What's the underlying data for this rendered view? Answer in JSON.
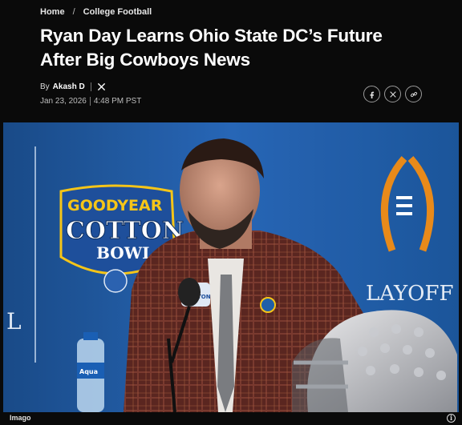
{
  "breadcrumb": {
    "home": "Home",
    "separator": "/",
    "section": "College Football"
  },
  "article": {
    "title": "Ryan Day Learns Ohio State DC’s Future After Big Cowboys News",
    "byline_prefix": "By",
    "author": "Akash D",
    "date": "Jan 23, 2026",
    "time": "4:48 PM PST"
  },
  "share": {
    "icons": [
      "facebook-icon",
      "x-icon",
      "link-icon"
    ]
  },
  "hero": {
    "backdrop_text_goodyear": "GOODYEAR",
    "backdrop_text_cotton": "COTTON",
    "backdrop_text_bowl": "BOWL",
    "backdrop_text_playoff": "LAYOFF",
    "backdrop_letter_left": "L",
    "mic_flag_text": "COTTON",
    "bottle_label": "Aqua",
    "caption": "Imago",
    "info_glyph": "i"
  },
  "colors": {
    "background": "#0a0a0a",
    "backdrop_blue": "#1f5fa8",
    "accent_orange": "#e88a1a"
  }
}
